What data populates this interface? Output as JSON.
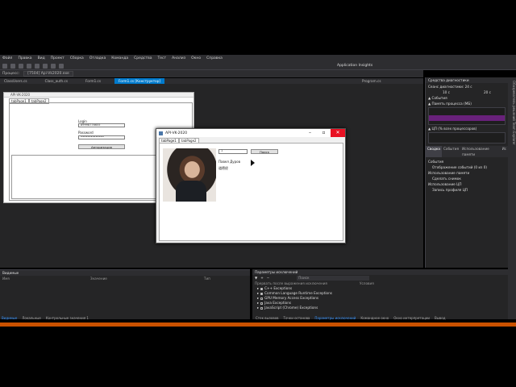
{
  "menubar": {
    "items": [
      "Файл",
      "Правка",
      "Вид",
      "Проект",
      "Сборка",
      "Отладка",
      "Команда",
      "Средства",
      "Тест",
      "Анализ",
      "Окно",
      "Справка"
    ]
  },
  "toolbar": {
    "app_insights_label": "Application Insights"
  },
  "process": {
    "label": "Процесс:",
    "value": "[7504] Api-Vk2020.exe"
  },
  "tabs": [
    {
      "label": "ClassUsers.cs"
    },
    {
      "label": "Class_auth.cs"
    },
    {
      "label": "Form1.cs"
    },
    {
      "label": "Form1.cs [Конструктор]",
      "active": true
    },
    {
      "label": "Program.cs"
    }
  ],
  "designer": {
    "caption": "API-VK-2020",
    "tabs": [
      "tabPage1",
      "tabPage2"
    ],
    "login_label": "Login",
    "login_value": "89998776655",
    "password_label": "Password",
    "password_value": "••••••••••••••",
    "auth_button": "Авторизация"
  },
  "runtime_window": {
    "title": "API-VK-2020",
    "tabs": [
      "tabPage1",
      "tabPage2"
    ],
    "id_input_value": "1",
    "search_button": "Поиск",
    "user_name": "Павел Дуров",
    "status_text": "道德经"
  },
  "diagnostics": {
    "header": "Средства диагностики",
    "session_label": "Сеанс диагностики: 24 с",
    "time_left": "10 с",
    "time_right": "20 с",
    "events_label": "▲ События",
    "memory_label": "▲ Память процесса (МБ)",
    "cpu_label": "▲ ЦП (% всех процессоров)",
    "tabs": [
      "Сводка",
      "События",
      "Использование памяти",
      "Ис"
    ],
    "events_section": "События",
    "events_item": "Отображение событий (0 из 0)",
    "memory_section": "Использование памяти",
    "memory_item": "Сделать снимок",
    "cpu_section": "Использование ЦП",
    "cpu_item": "Запись профиля ЦП",
    "side_strip": "Обозреватель решений  Team Explorer"
  },
  "autos_panel": {
    "title": "Видимые",
    "columns": [
      "Имя",
      "Значение",
      "Тип"
    ],
    "bottom_tabs": [
      "Видимые",
      "Локальные",
      "Контрольные значения 1"
    ]
  },
  "exceptions_panel": {
    "title": "Параметры исключений",
    "search_placeholder": "Поиск",
    "columns": [
      "Прервать после выражения исключения",
      "Условия"
    ],
    "items": [
      {
        "label": "C++ Exceptions",
        "checked": true
      },
      {
        "label": "Common Language Runtime Exceptions",
        "checked": true
      },
      {
        "label": "GPU Memory Access Exceptions",
        "checked": false
      },
      {
        "label": "Java Exceptions",
        "checked": false
      },
      {
        "label": "JavaScript (Chrome) Exceptions",
        "checked": false
      }
    ],
    "bottom_tabs": [
      "Стек вызовов",
      "Точки останова",
      "Параметры исключений",
      "Командное окно",
      "Окно интерпретации",
      "Вывод"
    ]
  },
  "colors": {
    "accent": "#007acc",
    "statusbar": "#ca5100",
    "ide_bg": "#252526",
    "chrome": "#2d2d30"
  }
}
